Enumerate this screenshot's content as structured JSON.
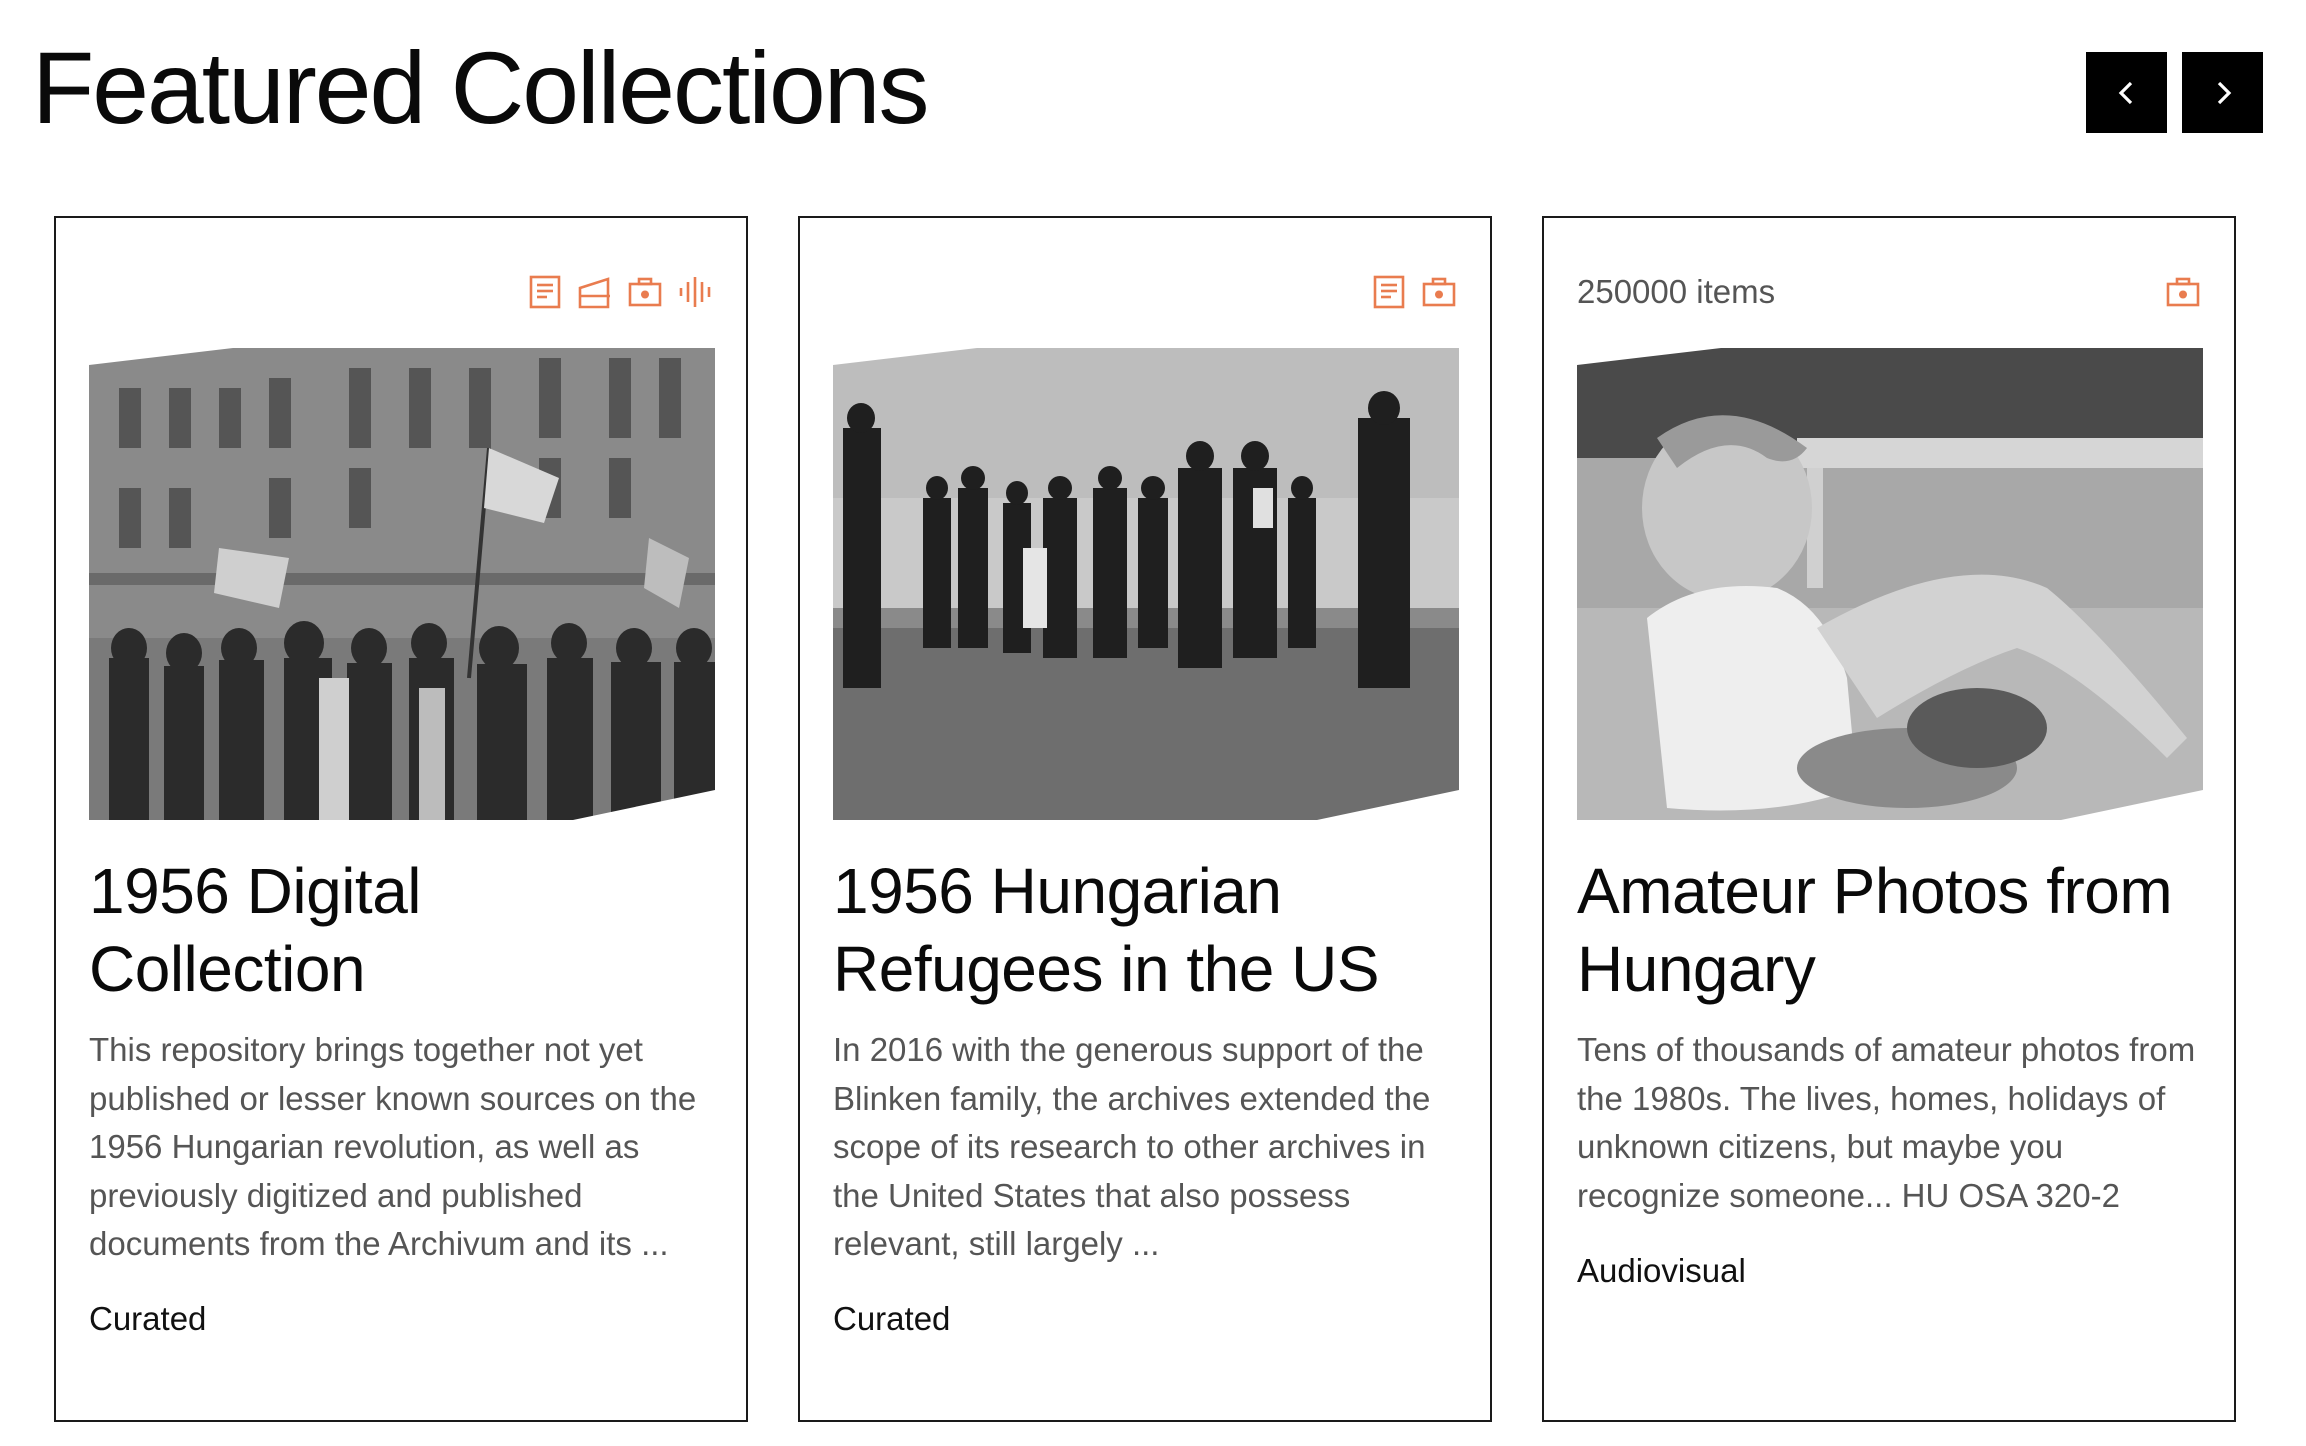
{
  "page": {
    "title": "Featured Collections",
    "nav": {
      "prev_icon": "chevron-left-icon",
      "next_icon": "chevron-right-icon"
    }
  },
  "colors": {
    "accent": "#E97C4F",
    "nav_bg": "#000000",
    "card_border": "#1a1a1a"
  },
  "cards": [
    {
      "count": "",
      "icons": [
        "document-icon",
        "folder-icon",
        "camera-icon",
        "audio-icon"
      ],
      "title": "1956 Digital Collection",
      "description": "This repository brings together not yet published or lesser known sources on the 1956 Hungarian revolution, as well as previously digitized and published documents from the Archivum and its ...",
      "type": "Curated"
    },
    {
      "count": "",
      "icons": [
        "document-icon",
        "camera-icon"
      ],
      "title": "1956 Hungarian Refugees in the US",
      "description": "In 2016 with the generous support of the Blinken family, the archives extended the scope of its research to other archives in the United States that also possess relevant, still largely ...",
      "type": "Curated"
    },
    {
      "count": "250000 items",
      "icons": [
        "camera-icon"
      ],
      "title": "Amateur Photos from Hungary",
      "description": "Tens of thousands of amateur photos from the 1980s. The lives, homes, holidays of unknown citizens, but maybe you recognize someone... HU OSA 320-2",
      "type": "Audiovisual"
    }
  ]
}
